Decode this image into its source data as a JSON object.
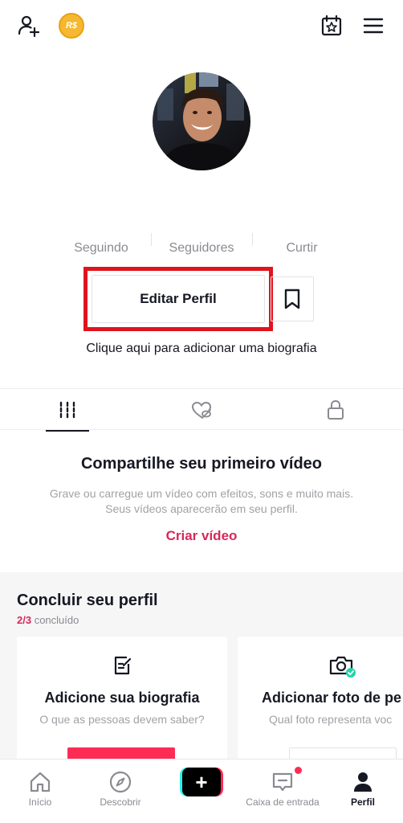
{
  "header": {
    "add_user_icon": "person-plus-icon",
    "coin_label": "R$",
    "calendar_icon": "calendar-star-icon",
    "menu_icon": "hamburger-menu-icon"
  },
  "profile": {
    "avatar_icon": "avatar-photo"
  },
  "stats": {
    "following_label": "Seguindo",
    "followers_label": "Seguidores",
    "likes_label": "Curtir"
  },
  "actions": {
    "edit_profile_label": "Editar Perfil",
    "bookmark_icon": "bookmark-icon",
    "bio_prompt": "Clique aqui para adicionar uma biografia"
  },
  "tabs": [
    {
      "name": "videos",
      "icon": "grid-bars-icon",
      "active": true
    },
    {
      "name": "liked",
      "icon": "heart-hidden-icon",
      "active": false
    },
    {
      "name": "private",
      "icon": "lock-icon",
      "active": false
    }
  ],
  "empty_state": {
    "title": "Compartilhe seu primeiro vídeo",
    "description": "Grave ou carregue um vídeo com efeitos, sons e muito mais. Seus vídeos aparecerão em seu perfil.",
    "cta": "Criar vídeo"
  },
  "complete_profile": {
    "title": "Concluir seu perfil",
    "progress_count": "2/3",
    "progress_label": "concluído",
    "cards": [
      {
        "icon": "edit-note-icon",
        "title": "Adicione sua biografia",
        "subtitle": "O que as pessoas devem saber?"
      },
      {
        "icon": "camera-check-icon",
        "title": "Adicionar foto de pe",
        "subtitle": "Qual foto representa voc"
      }
    ]
  },
  "bottom_nav": [
    {
      "label": "Início",
      "icon": "home-icon",
      "active": false
    },
    {
      "label": "Descobrir",
      "icon": "compass-icon",
      "active": false
    },
    {
      "label": "",
      "icon": "plus-icon",
      "active": false
    },
    {
      "label": "Caixa de entrada",
      "icon": "inbox-icon",
      "active": false,
      "badge": true
    },
    {
      "label": "Perfil",
      "icon": "person-icon",
      "active": true
    }
  ],
  "colors": {
    "accent": "#d6295a",
    "highlight": "#e0141d",
    "text_primary": "#161823",
    "text_secondary": "#8a8b91"
  }
}
